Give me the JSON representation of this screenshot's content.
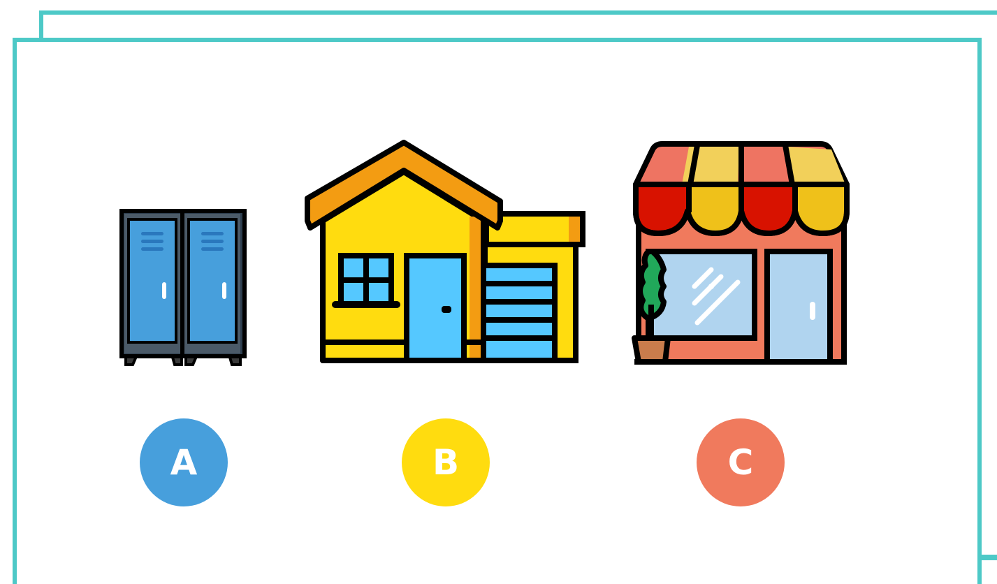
{
  "options": [
    {
      "letter": "A",
      "color": "#479fdc",
      "icon": "lockers-icon"
    },
    {
      "letter": "B",
      "color": "#ffdc0f",
      "icon": "house-icon"
    },
    {
      "letter": "C",
      "color": "#f07a5d",
      "icon": "storefront-icon"
    }
  ],
  "frame_color": "#4dc9c7"
}
